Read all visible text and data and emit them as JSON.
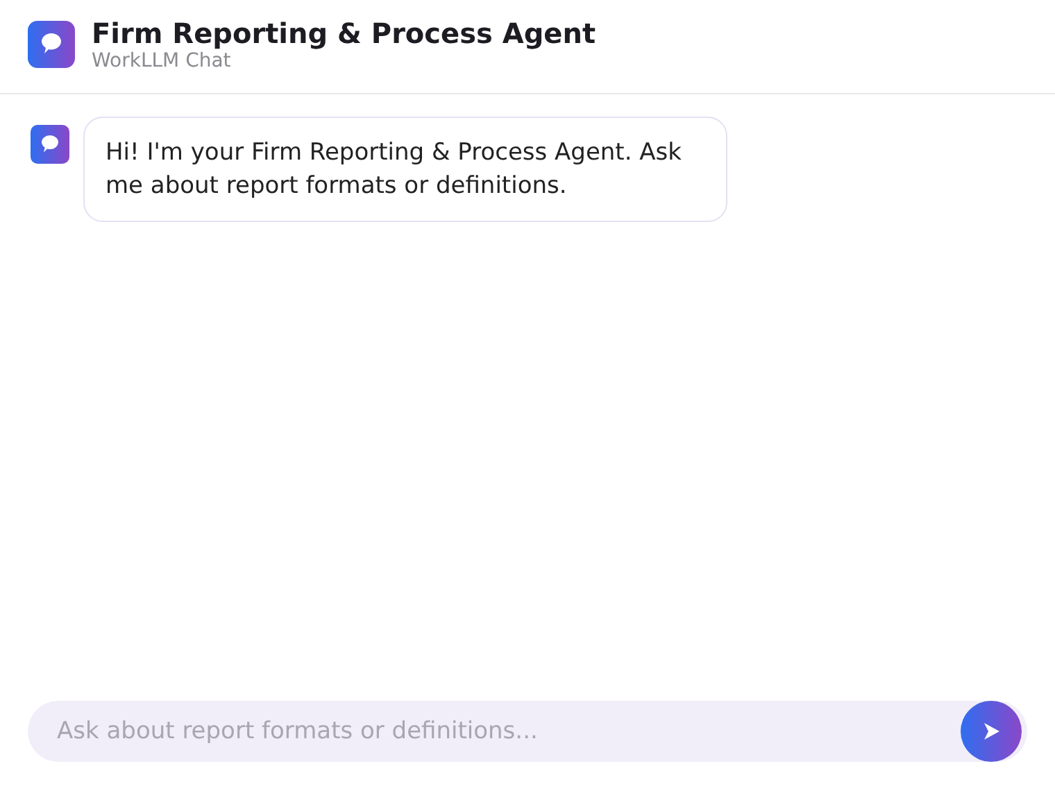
{
  "header": {
    "title": "Firm Reporting & Process Agent",
    "subtitle": "WorkLLM Chat"
  },
  "messages": [
    {
      "kind": "agent",
      "text": "Hi! I'm your Firm Reporting & Process Agent. Ask me about report formats or definitions."
    }
  ],
  "composer": {
    "placeholder": "Ask about report formats or definitions..."
  }
}
